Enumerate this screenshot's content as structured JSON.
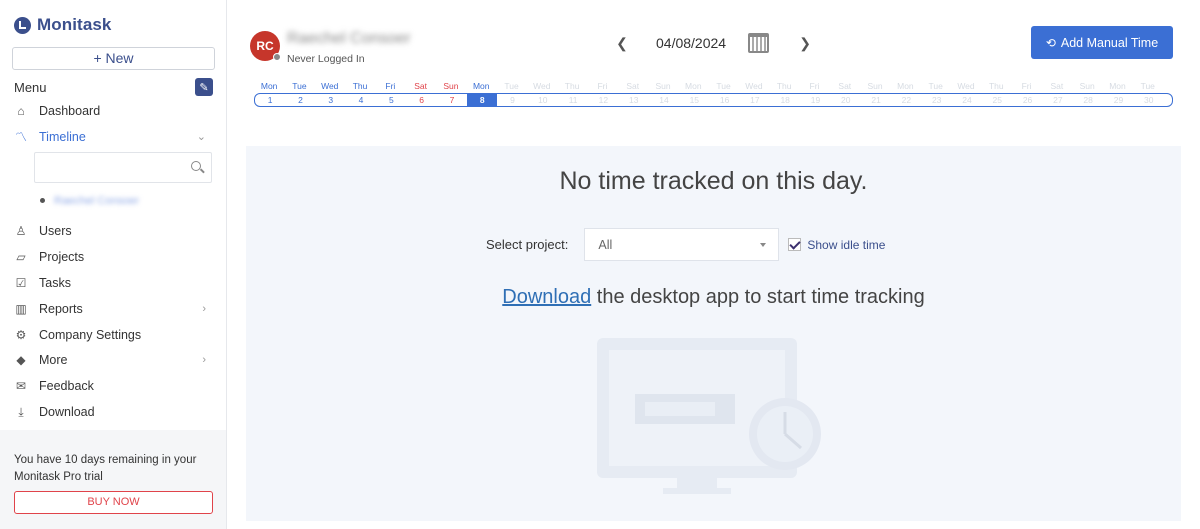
{
  "brand": {
    "name": "Monitask"
  },
  "sidebar": {
    "new_label": "+ New",
    "menu_label": "Menu",
    "items": [
      {
        "label": "Dashboard",
        "icon": "home-icon"
      },
      {
        "label": "Timeline",
        "icon": "trend-line-icon",
        "active": true
      },
      {
        "label": "Users",
        "icon": "user-icon"
      },
      {
        "label": "Projects",
        "icon": "project-icon"
      },
      {
        "label": "Tasks",
        "icon": "tasks-icon"
      },
      {
        "label": "Reports",
        "icon": "chart-icon"
      },
      {
        "label": "Company Settings",
        "icon": "gear-icon"
      },
      {
        "label": "More",
        "icon": "tag-icon"
      },
      {
        "label": "Feedback",
        "icon": "feedback-icon"
      },
      {
        "label": "Download",
        "icon": "download-icon"
      }
    ],
    "search_placeholder": "",
    "sub_user": "Raechel Consoer",
    "trial_message": "You have 10 days remaining in your Monitask Pro trial",
    "buy_label": "BUY NOW"
  },
  "header": {
    "avatar_initials": "RC",
    "user_name": "Raechel Consoer",
    "status": "Never Logged In",
    "date": "04/08/2024",
    "add_manual_label": "Add Manual Time"
  },
  "calendar": {
    "days": [
      "Mon",
      "Tue",
      "Wed",
      "Thu",
      "Fri",
      "Sat",
      "Sun",
      "Mon",
      "Tue",
      "Wed",
      "Thu",
      "Fri",
      "Sat",
      "Sun",
      "Mon",
      "Tue",
      "Wed",
      "Thu",
      "Fri",
      "Sat",
      "Sun",
      "Mon",
      "Tue",
      "Wed",
      "Thu",
      "Fri",
      "Sat",
      "Sun",
      "Mon",
      "Tue"
    ],
    "selected": 8,
    "weekend_highlight": [
      6,
      7
    ]
  },
  "content": {
    "empty_title": "No time tracked on this day.",
    "select_project_label": "Select project:",
    "project_value": "All",
    "show_idle_label": "Show idle time",
    "download_link": "Download",
    "download_rest": " the desktop app to start time tracking"
  },
  "colors": {
    "accent": "#3b6fd4",
    "brand": "#3b4f8c",
    "danger": "#e0434a",
    "avatar": "#c6362b"
  }
}
